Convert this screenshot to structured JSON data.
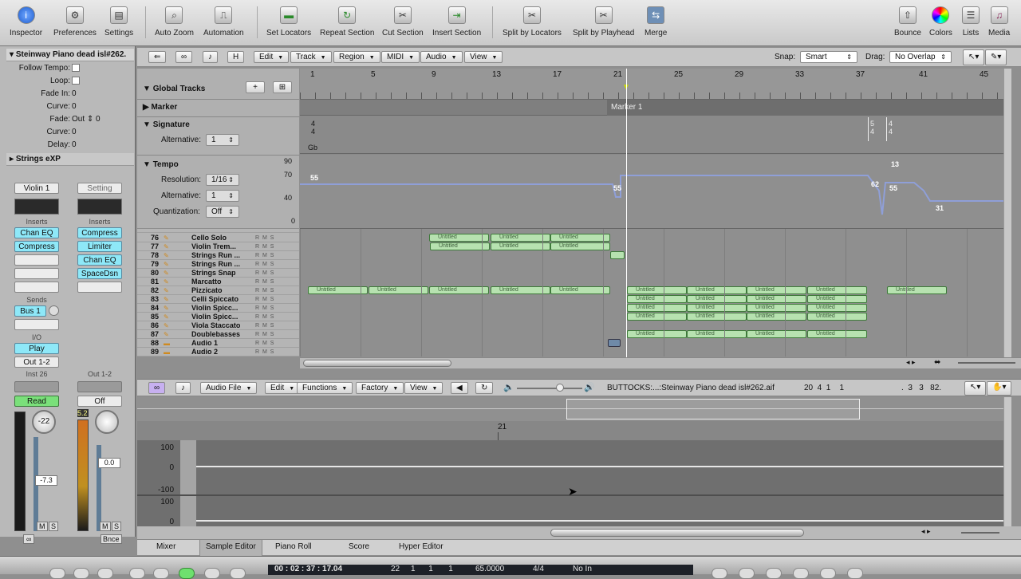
{
  "toolbar": {
    "items": [
      {
        "label": "Inspector",
        "icon": "inspector-icon"
      },
      {
        "label": "Preferences",
        "icon": "preferences-icon"
      },
      {
        "label": "Settings",
        "icon": "settings-icon"
      },
      {
        "label": "Auto Zoom",
        "icon": "auto-zoom-icon"
      },
      {
        "label": "Automation",
        "icon": "automation-icon"
      },
      {
        "label": "Set Locators",
        "icon": "set-locators-icon"
      },
      {
        "label": "Repeat Section",
        "icon": "repeat-section-icon"
      },
      {
        "label": "Cut Section",
        "icon": "cut-section-icon"
      },
      {
        "label": "Insert Section",
        "icon": "insert-section-icon"
      },
      {
        "label": "Split by Locators",
        "icon": "split-locators-icon"
      },
      {
        "label": "Split by Playhead",
        "icon": "split-playhead-icon"
      },
      {
        "label": "Merge",
        "icon": "merge-icon"
      },
      {
        "label": "Bounce",
        "icon": "bounce-icon"
      },
      {
        "label": "Colors",
        "icon": "colors-icon"
      },
      {
        "label": "Lists",
        "icon": "lists-icon"
      },
      {
        "label": "Media",
        "icon": "media-icon"
      }
    ]
  },
  "inspector": {
    "region_title": "Steinway Piano dead isl#262.",
    "rows": [
      {
        "label": "Follow Tempo:",
        "value": ""
      },
      {
        "label": "Loop:",
        "value": ""
      },
      {
        "label": "Fade In:",
        "value": "0"
      },
      {
        "label": "Curve:",
        "value": "0"
      },
      {
        "label": "Fade:",
        "value": "Out  ⇕ 0"
      },
      {
        "label": "Curve:",
        "value": "0"
      },
      {
        "label": "Delay:",
        "value": "0"
      }
    ],
    "track_title": "Strings eXP",
    "strip1": {
      "name": "Violin 1",
      "inserts_label": "Inserts",
      "inserts": [
        "Chan EQ",
        "Compress"
      ],
      "sends_label": "Sends",
      "send": "Bus 1",
      "io_label": "I/O",
      "input": "Play",
      "output": "Out 1-2",
      "group": "Inst 26",
      "automation": "Read",
      "pan": "-22",
      "volume": "-7.3",
      "mute": "M",
      "solo": "S"
    },
    "strip2": {
      "name": "Setting",
      "inserts_label": "Inserts",
      "inserts": [
        "Compress",
        "Limiter",
        "Chan EQ",
        "SpaceDsn"
      ],
      "output": "Out 1-2",
      "automation": "Off",
      "volume": "0.0",
      "peak": "5.2",
      "mute": "M",
      "solo": "S",
      "bounce": "Bnce"
    }
  },
  "arrange": {
    "menus": [
      "Edit",
      "Track",
      "Region",
      "MIDI",
      "Audio",
      "View"
    ],
    "snap_label": "Snap:",
    "snap_value": "Smart",
    "drag_label": "Drag:",
    "drag_value": "No Overlap",
    "ruler": [
      "1",
      "5",
      "9",
      "13",
      "17",
      "21",
      "25",
      "29",
      "33",
      "37",
      "41",
      "45"
    ],
    "global_tracks_label": "Global Tracks",
    "marker_label": "Marker",
    "marker_name": "Marker 1",
    "signature_label": "Signature",
    "alternative_label": "Alternative:",
    "alternative_value": "1",
    "sig1_top": "4",
    "sig1_bottom": "4",
    "key": "Gb",
    "sig2_top": "5",
    "sig2_bottom": "4",
    "sig3_top": "4",
    "sig3_bottom": "4",
    "tempo_label": "Tempo",
    "resolution_label": "Resolution:",
    "resolution_value": "1/16",
    "tempo_alt_label": "Alternative:",
    "tempo_alt_value": "1",
    "quant_label": "Quantization:",
    "quant_value": "Off",
    "tempo_scale": [
      "90",
      "70",
      "40",
      "0"
    ],
    "tempo_values": [
      "55",
      "55",
      "13",
      "62",
      "55",
      "31"
    ],
    "tracks": [
      {
        "num": "76",
        "name": "Cello Solo"
      },
      {
        "num": "77",
        "name": "Violin Trem..."
      },
      {
        "num": "78",
        "name": "Strings Run ..."
      },
      {
        "num": "79",
        "name": "Strings Run ..."
      },
      {
        "num": "80",
        "name": "Strings Snap"
      },
      {
        "num": "81",
        "name": "Marcatto"
      },
      {
        "num": "82",
        "name": "Pizzicato"
      },
      {
        "num": "83",
        "name": "Celli Spiccato"
      },
      {
        "num": "84",
        "name": "Violin Spicc..."
      },
      {
        "num": "85",
        "name": "Violin Spicc..."
      },
      {
        "num": "86",
        "name": "Viola Staccato"
      },
      {
        "num": "87",
        "name": "Doublebasses"
      },
      {
        "num": "88",
        "name": "Audio 1"
      },
      {
        "num": "89",
        "name": "Audio 2"
      }
    ],
    "region_label": "Untitled"
  },
  "sample_editor": {
    "menus": [
      "Audio File",
      "Edit",
      "Functions",
      "Factory",
      "View"
    ],
    "file_name": "BUTTOCKS:...:Steinway Piano dead isl#262.aif",
    "position": "20  4  1    1",
    "length": ".  3   3   82.",
    "ruler_mark": "21",
    "y_labels": [
      "100",
      "0",
      "-100",
      "100",
      "0"
    ]
  },
  "bottom_tabs": [
    "Mixer",
    "Sample Editor",
    "Piano Roll",
    "Score",
    "Hyper Editor"
  ],
  "transport": {
    "time": "00 : 02 : 37 : 17.04",
    "bars": "22     1      1       1",
    "tempo": "65.0000",
    "signature": "4/4",
    "in_label": "No In"
  }
}
